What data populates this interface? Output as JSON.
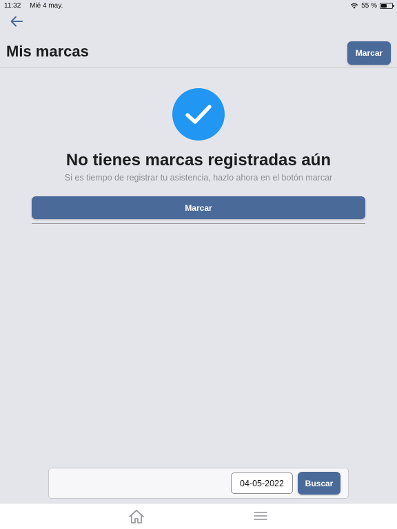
{
  "status_bar": {
    "time": "11:32",
    "date": "Mié 4 may.",
    "battery_text": "55 %",
    "battery_level": 0.55,
    "wifi_icon": "wifi-icon"
  },
  "header": {
    "back_icon": "arrow-left-icon",
    "title": "Mis marcas",
    "action_label": "Marcar"
  },
  "empty_state": {
    "icon": "checkmark-icon",
    "title": "No tienes marcas registradas aún",
    "subtitle": "Si es tiempo de registrar tu asistencia, hazlo ahora en el botón marcar",
    "button_label": "Marcar"
  },
  "search": {
    "date_value": "04-05-2022",
    "button_label": "Buscar"
  },
  "tab_bar": {
    "items": [
      {
        "icon": "home-icon"
      },
      {
        "icon": "menu-icon"
      }
    ]
  },
  "colors": {
    "accent": "#4a6a9a",
    "check": "#2196f3",
    "background": "#e4e5ea"
  }
}
